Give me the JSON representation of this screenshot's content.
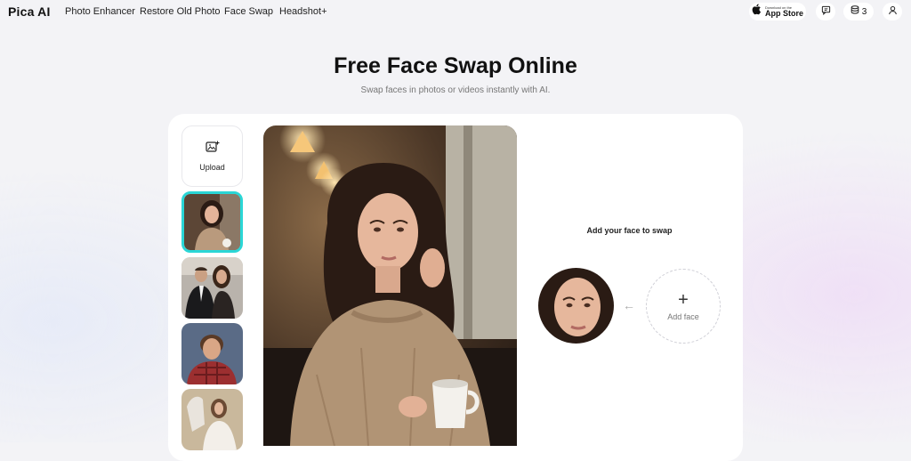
{
  "nav": {
    "logo": "Pica AI",
    "links": [
      "Photo Enhancer",
      "Restore Old Photo",
      "Face Swap",
      "Headshot+"
    ],
    "app_store_small": "Download on the",
    "app_store_big": "App Store",
    "credits": "3"
  },
  "hero": {
    "title": "Free Face Swap Online",
    "subtitle": "Swap faces in photos or videos instantly with AI."
  },
  "panel": {
    "upload_label": "Upload",
    "add_title": "Add your face to swap",
    "add_face_label": "Add face"
  },
  "colors": {
    "accent": "#2ad6d6"
  }
}
